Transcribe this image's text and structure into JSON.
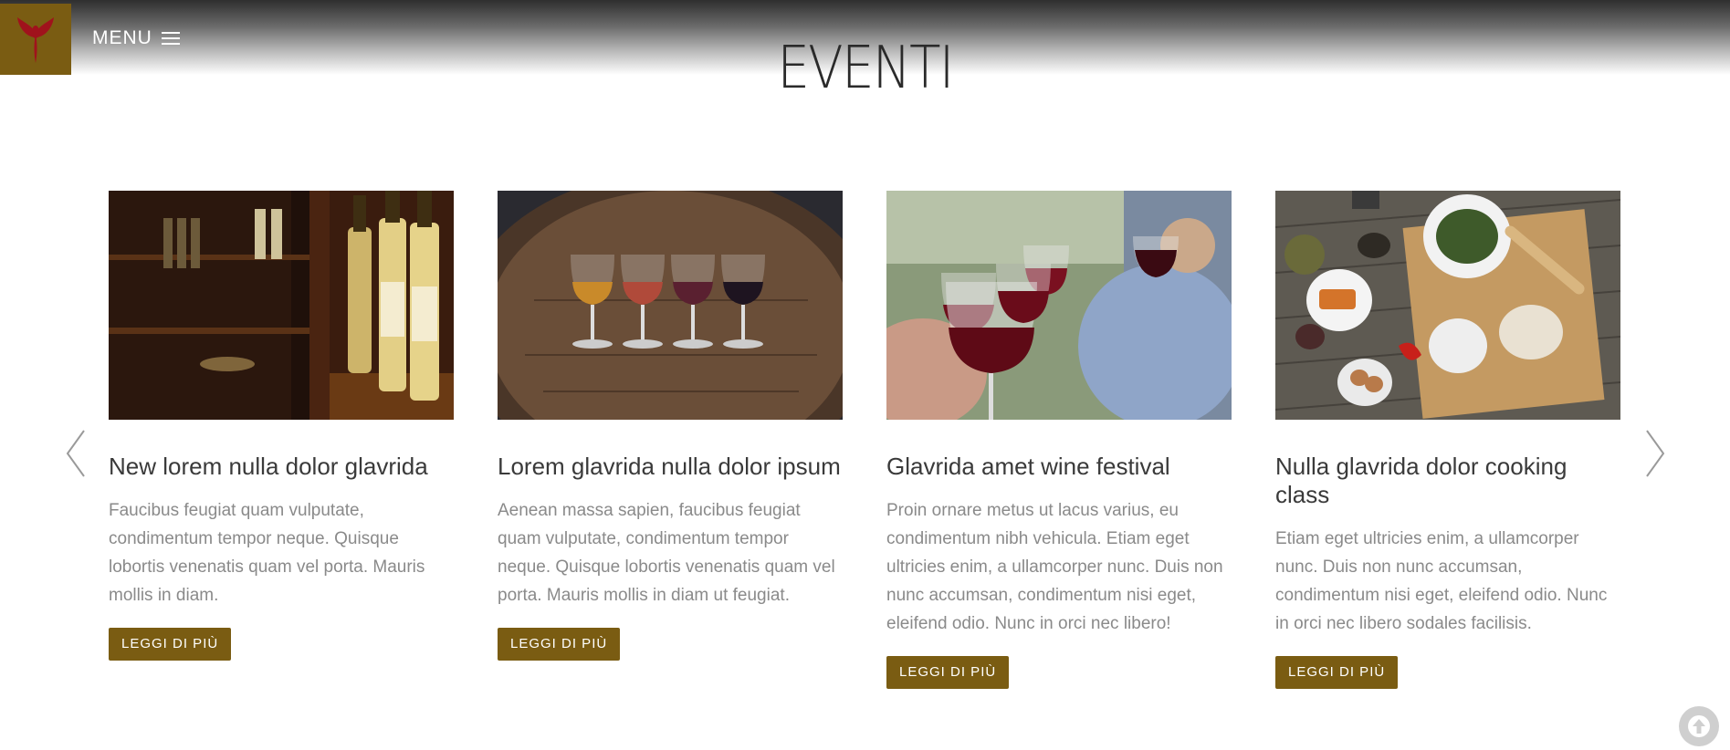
{
  "header": {
    "menu_label": "MENU",
    "page_title": "EVENTI"
  },
  "events": [
    {
      "title": "New lorem nulla dolor glavrida",
      "text": "Faucibus feugiat quam vulputate, condimentum tempor neque. Quisque lobortis venenatis quam vel porta. Mauris mollis in diam.",
      "button": "LEGGI DI PIÙ",
      "image": "wine-bottles-on-shelf"
    },
    {
      "title": "Lorem glavrida nulla dolor ipsum",
      "text": "Aenean massa sapien, faucibus feugiat quam vulputate, condimentum tempor neque. Quisque lobortis venenatis quam vel porta. Mauris mollis in diam ut feugiat.",
      "button": "LEGGI DI PIÙ",
      "image": "wine-glasses-on-barrel"
    },
    {
      "title": "Glavrida amet wine festival",
      "text": "Proin ornare metus ut lacus varius, eu condimentum nibh vehicula. Etiam eget ultricies enim, a ullamcorper nunc. Duis non nunc accumsan, condimentum nisi eget, eleifend odio. Nunc in orci nec libero!",
      "button": "LEGGI DI PIÙ",
      "image": "people-toasting-red-wine"
    },
    {
      "title": "Nulla glavrida dolor cooking class",
      "text": "Etiam eget ultricies enim, a ullamcorper nunc. Duis non nunc accumsan, condimentum nisi eget, eleifend odio. Nunc in orci nec libero sodales facilisis.",
      "button": "LEGGI DI PIÙ",
      "image": "cooking-ingredients-table"
    }
  ],
  "colors": {
    "accent": "#7a5c12",
    "title": "#3a3a3a",
    "body_text": "#8a8a8a"
  },
  "icons": {
    "logo": "wine-leaf-logo",
    "menu": "hamburger-icon",
    "prev": "chevron-left-icon",
    "next": "chevron-right-icon",
    "scroll_top": "arrow-up-icon"
  }
}
